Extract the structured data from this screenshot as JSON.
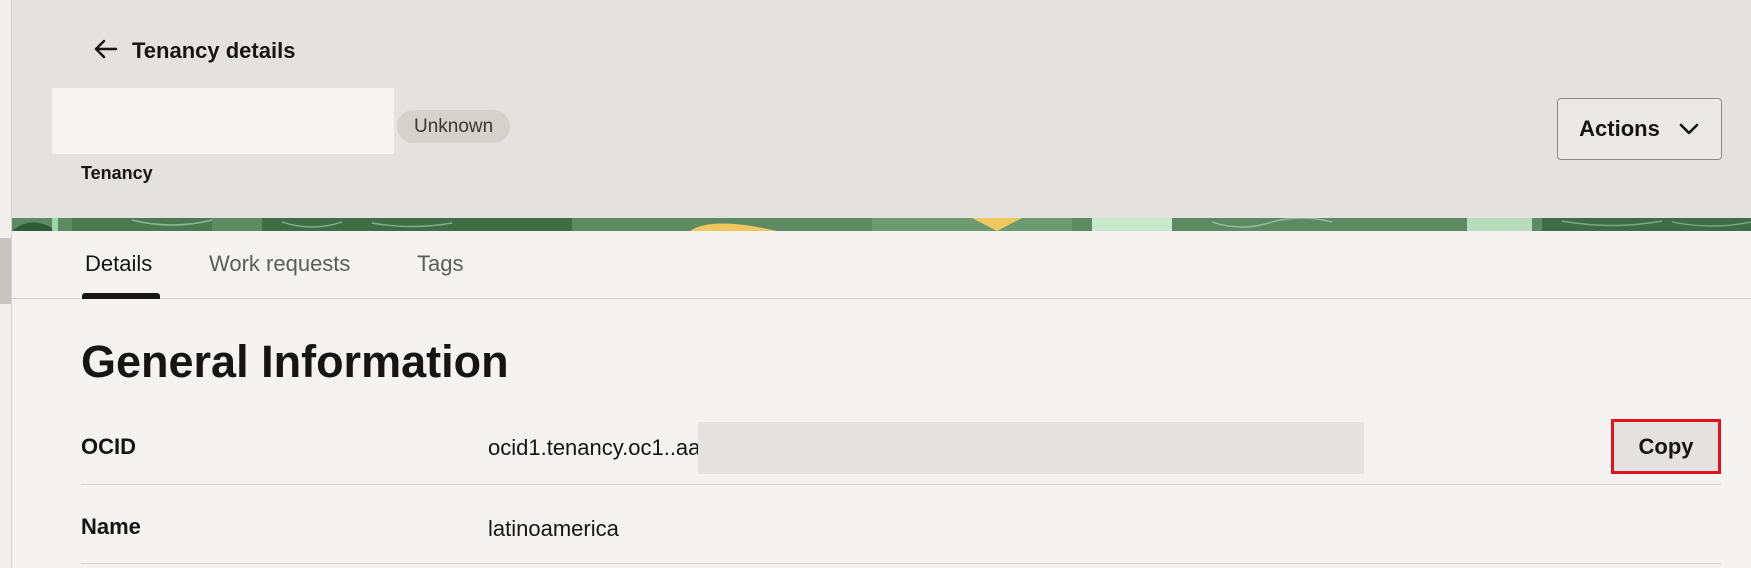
{
  "header": {
    "back_label": "Tenancy details",
    "status": "Unknown",
    "subtitle": "Tenancy",
    "actions_label": "Actions"
  },
  "tabs": [
    {
      "label": "Details",
      "active": true
    },
    {
      "label": "Work requests",
      "active": false
    },
    {
      "label": "Tags",
      "active": false
    }
  ],
  "general_information": {
    "title": "General Information",
    "rows": [
      {
        "label": "OCID",
        "value": "ocid1.tenancy.oc1..aa",
        "action": "Copy"
      },
      {
        "label": "Name",
        "value": "latinoamerica"
      }
    ]
  },
  "colors": {
    "copy_highlight": "#e0141e",
    "banner_green": "#5d8a63",
    "banner_yellow": "#f0c75e"
  },
  "icons": {
    "back": "arrow-left-icon",
    "actions": "chevron-down-icon"
  }
}
